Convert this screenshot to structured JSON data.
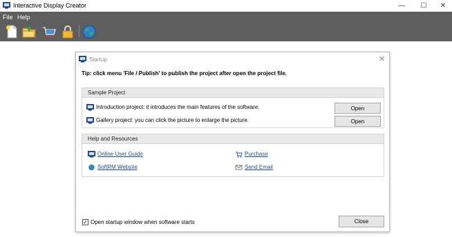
{
  "window": {
    "title": "Interactive Display Creator",
    "controls": {
      "minimize": "—",
      "maximize": "☐",
      "close": "✕"
    }
  },
  "menu": {
    "items": [
      {
        "label": "File"
      },
      {
        "label": "Help"
      }
    ]
  },
  "toolbar": {
    "buttons": [
      {
        "icon": "new-file-icon"
      },
      {
        "icon": "open-folder-icon"
      },
      {
        "icon": "cart-icon"
      },
      {
        "icon": "lock-icon"
      },
      {
        "icon": "globe-icon"
      }
    ]
  },
  "dialog": {
    "title": "Startup",
    "close_glyph": "✕",
    "tip": "Tip: click menu 'File / Publish' to publish the project after open the project file.",
    "sample_project": {
      "header": "Sample Project",
      "items": [
        {
          "text": "Introduction project: it introduces the main features of the software.",
          "button": "Open"
        },
        {
          "text": "Gallery project: you can click the picture to enlarge the picture.",
          "button": "Open"
        }
      ]
    },
    "help": {
      "header": "Help and Resources",
      "links": {
        "user_guide": "Online User Guide",
        "purchase": "Purchase",
        "website": "SoftRM Website",
        "email": "Send Email"
      }
    },
    "startup_checkbox": {
      "label": "Open startup window when software starts",
      "checked": true,
      "mark": "✓"
    },
    "close_button": "Close"
  },
  "colors": {
    "toolbar_bg": "#5e5e5e",
    "link": "#1a4f9c",
    "group_header_bg": "#e8e8e8"
  }
}
